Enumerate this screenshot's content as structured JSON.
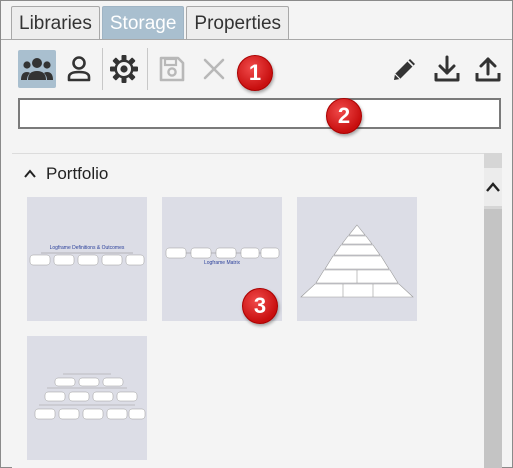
{
  "tabs": [
    {
      "label": "Libraries",
      "active": false
    },
    {
      "label": "Storage",
      "active": true
    },
    {
      "label": "Properties",
      "active": false
    }
  ],
  "toolbar": {
    "left_icons": [
      "group-icon",
      "person-icon",
      "gear-icon",
      "save-icon",
      "close-icon"
    ],
    "right_icons": [
      "pencil-icon",
      "download-icon",
      "upload-icon"
    ],
    "active_icon": "group-icon"
  },
  "search": {
    "value": "",
    "placeholder": ""
  },
  "section": {
    "title": "Portfolio",
    "expanded": true
  },
  "thumbnails": [
    {
      "title": "Logframe Definitions & Outcomes"
    },
    {
      "title": "Logframe Matrix"
    },
    {
      "title": "Pyramid diagram"
    },
    {
      "title": "Organization chart"
    }
  ],
  "callouts": [
    "1",
    "2",
    "3"
  ],
  "colors": {
    "accent": "#a9bfcf",
    "callout": "#d81e1e",
    "thumb_bg": "#dcdde6"
  }
}
